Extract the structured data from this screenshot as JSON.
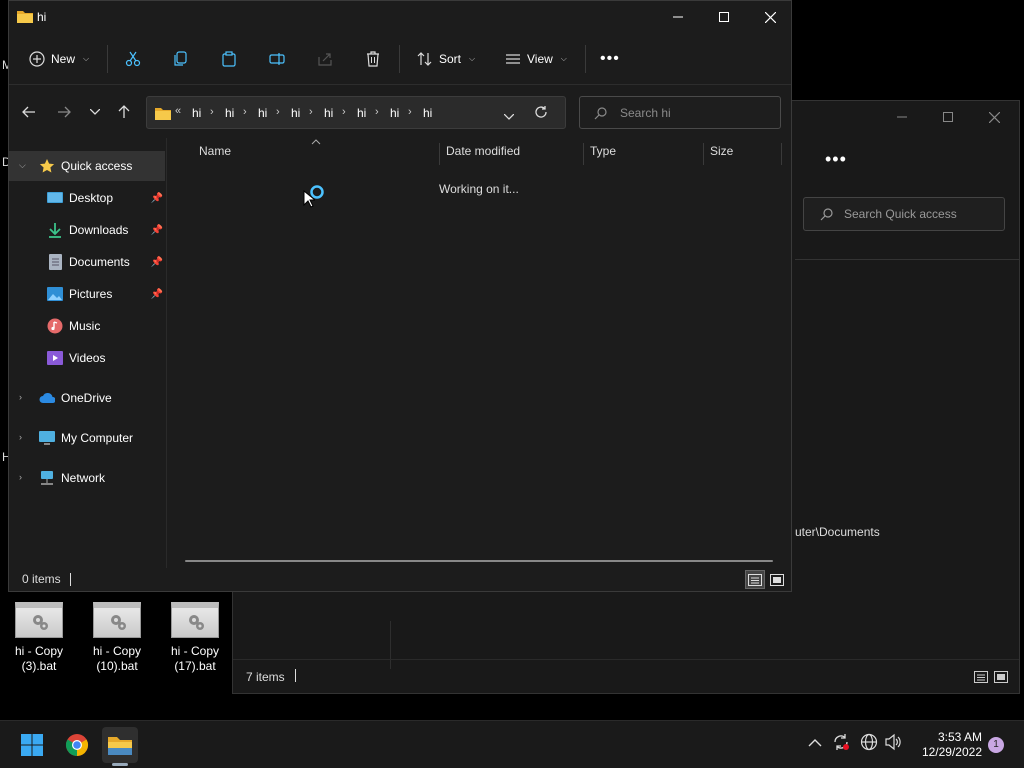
{
  "desktop": {
    "fragments": [
      "D",
      "M",
      "H"
    ],
    "icons": [
      {
        "label": "hi - Copy\n(3).bat"
      },
      {
        "label": "hi - Copy\n(10).bat"
      },
      {
        "label": "hi - Copy\n(17).bat"
      }
    ]
  },
  "back_window": {
    "search_placeholder": "Search Quick access",
    "more_label": "•••",
    "path_fragment": "uter\\Documents",
    "status": "7 items"
  },
  "window": {
    "title": "hi",
    "toolbar": {
      "new_label": "New",
      "sort_label": "Sort",
      "view_label": "View",
      "more_label": "•••"
    },
    "address": {
      "overflow": "«",
      "crumbs": [
        "hi",
        "hi",
        "hi",
        "hi",
        "hi",
        "hi",
        "hi",
        "hi"
      ]
    },
    "search_placeholder": "Search hi",
    "sidebar": {
      "quick_access": "Quick access",
      "desktop": "Desktop",
      "downloads": "Downloads",
      "documents": "Documents",
      "pictures": "Pictures",
      "music": "Music",
      "videos": "Videos",
      "onedrive": "OneDrive",
      "my_computer": "My Computer",
      "network": "Network"
    },
    "columns": {
      "name": "Name",
      "date_modified": "Date modified",
      "type": "Type",
      "size": "Size"
    },
    "loading_text": "Working on it...",
    "status": "0 items"
  },
  "taskbar": {
    "time": "3:53 AM",
    "date": "12/29/2022",
    "notification_count": "1"
  },
  "colors": {
    "accent": "#4cc2ff",
    "folder": "#f6c94a",
    "background": "#1c1c1c"
  }
}
